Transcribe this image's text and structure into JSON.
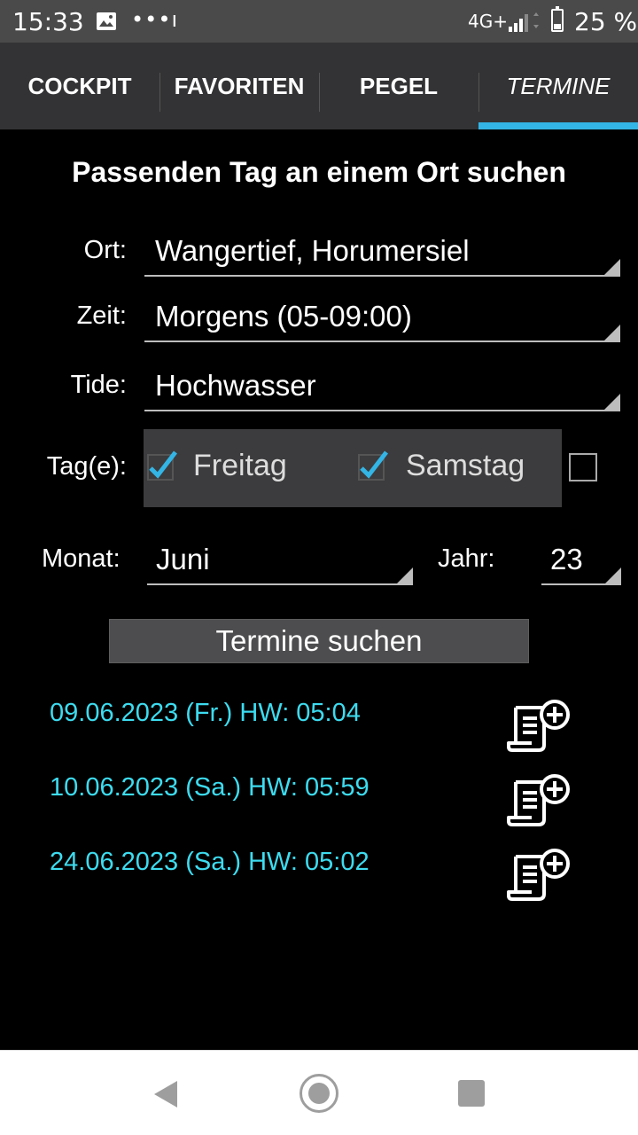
{
  "status_bar": {
    "time": "15:33",
    "dots": "•••ı",
    "network": "4G+",
    "battery": "25 %",
    "battery_level": 0.25
  },
  "tabs": [
    {
      "label": "COCKPIT",
      "active": false
    },
    {
      "label": "FAVORITEN",
      "active": false
    },
    {
      "label": "PEGEL",
      "active": false
    },
    {
      "label": "TERMINE",
      "active": true
    }
  ],
  "accent_color": "#33b5e5",
  "result_color": "#3ddcf0",
  "heading": "Passenden Tag an einem Ort suchen",
  "form": {
    "ort_label": "Ort:",
    "ort_value": "Wangertief, Horumersiel",
    "zeit_label": "Zeit:",
    "zeit_value": "Morgens (05-09:00)",
    "tide_label": "Tide:",
    "tide_value": "Hochwasser",
    "tage_label": "Tag(e):",
    "days": [
      {
        "label": "Freitag",
        "checked": true
      },
      {
        "label": "Samstag",
        "checked": true
      },
      {
        "label": "",
        "checked": false
      }
    ],
    "monat_label": "Monat:",
    "monat_value": "Juni",
    "jahr_label": "Jahr:",
    "jahr_value": "23"
  },
  "search_button": "Termine suchen",
  "results": [
    {
      "text": "09.06.2023 (Fr.) HW: 05:04",
      "icon": "add-to-calendar-icon"
    },
    {
      "text": "10.06.2023 (Sa.) HW: 05:59",
      "icon": "add-to-calendar-icon"
    },
    {
      "text": "24.06.2023 (Sa.) HW: 05:02",
      "icon": "add-to-calendar-icon"
    }
  ],
  "nav": {
    "back": "back-icon",
    "home": "home-icon",
    "recent": "recent-apps-icon"
  }
}
